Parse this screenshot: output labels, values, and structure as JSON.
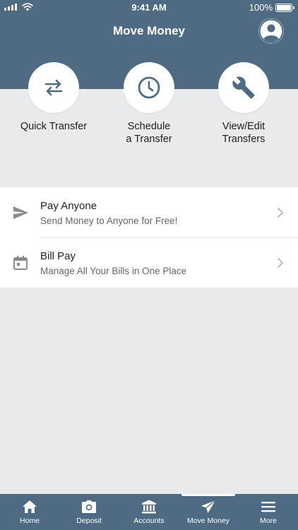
{
  "status_bar": {
    "time": "9:41 AM",
    "battery": "100%"
  },
  "header": {
    "title": "Move Money"
  },
  "quick_actions": [
    {
      "label": "Quick Transfer",
      "icon": "swap-arrows-icon"
    },
    {
      "label": "Schedule\na Transfer",
      "icon": "clock-icon"
    },
    {
      "label": "View/Edit\nTransfers",
      "icon": "wrench-icon"
    }
  ],
  "list": [
    {
      "title": "Pay Anyone",
      "subtitle": "Send Money to Anyone for Free!",
      "icon": "send-icon"
    },
    {
      "title": "Bill Pay",
      "subtitle": "Manage All Your Bills in One Place",
      "icon": "calendar-icon"
    }
  ],
  "tabs": [
    {
      "label": "Home",
      "icon": "home-icon"
    },
    {
      "label": "Deposit",
      "icon": "camera-icon"
    },
    {
      "label": "Accounts",
      "icon": "bank-icon"
    },
    {
      "label": "Move Money",
      "icon": "send-icon",
      "active": true
    },
    {
      "label": "More",
      "icon": "menu-icon"
    }
  ],
  "colors": {
    "primary": "#4e6b83",
    "background": "#e9eaec",
    "surface": "#ffffff"
  }
}
